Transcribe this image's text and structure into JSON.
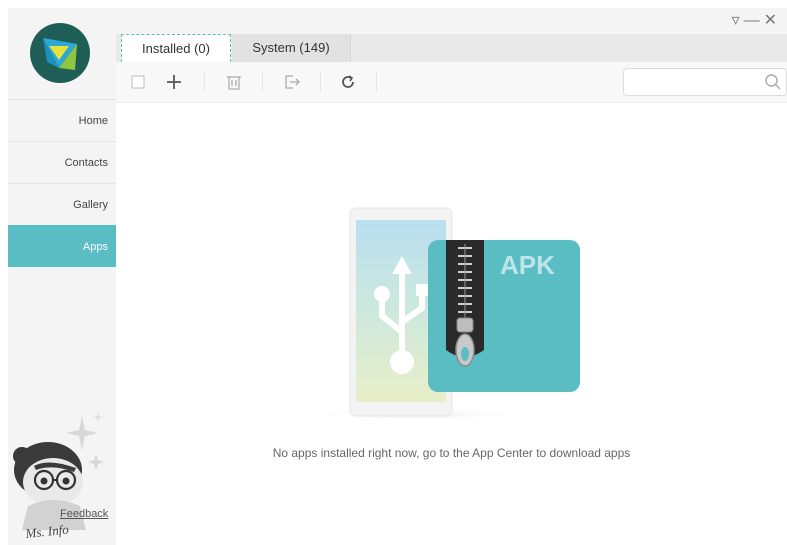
{
  "tabs": {
    "installed_label": "Installed (0)",
    "system_label": "System (149)"
  },
  "window_controls": {
    "minimize_glyph": "—",
    "close_glyph": "✕",
    "menu_glyph": "▿"
  },
  "sidebar": {
    "items": [
      {
        "label": "Home",
        "active": false
      },
      {
        "label": "Contacts",
        "active": false
      },
      {
        "label": "Gallery",
        "active": false
      },
      {
        "label": "Apps",
        "active": true
      }
    ],
    "feedback_label": "Feedback",
    "mascot_caption": "Ms. Info"
  },
  "toolbar": {
    "icons": [
      "checkbox-icon",
      "add-icon",
      "delete-icon",
      "export-icon",
      "refresh-icon"
    ]
  },
  "search": {
    "placeholder": "",
    "value": ""
  },
  "empty_state": {
    "badge_text": "APK",
    "message": "No apps installed right now, go to the App Center to download apps"
  },
  "colors": {
    "accent": "#5bbdc4",
    "apk_panel": "#5bbdc4",
    "sidebar_bg": "#f4f4f4"
  }
}
